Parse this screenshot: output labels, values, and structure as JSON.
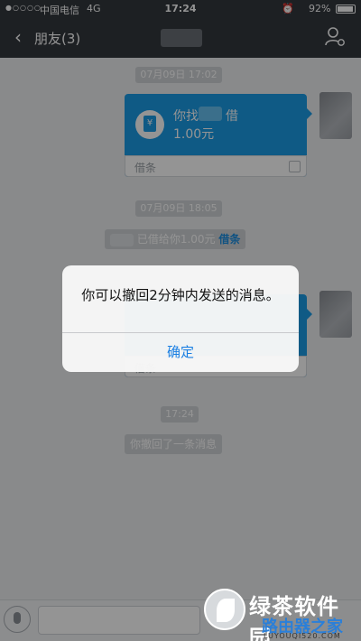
{
  "status_bar": {
    "signal": "●○○○○",
    "carrier": "中国电信",
    "network": "4G",
    "time": "17:24",
    "alarm_icon": "alarm-icon",
    "battery_text": "92%",
    "battery_level": 0.92
  },
  "nav": {
    "back_icon": "chevron-left-icon",
    "title": "朋友(3)",
    "profile_icon": "person-settings-icon"
  },
  "chat": {
    "timestamp1": "07月09日 17:02",
    "loan_bubble": {
      "line1_prefix": "你找",
      "line1_suffix": "借",
      "amount": "1.00元",
      "footer_label": "借条"
    },
    "timestamp2": "07月09日 18:05",
    "system_msg": {
      "text": "已借给你1.00元",
      "link": "借条"
    },
    "partial_footer": "借条",
    "timestamp3": "17:24",
    "recalled_msg": "你撤回了一条消息"
  },
  "alert": {
    "message": "你可以撤回2分钟内发送的消息。",
    "confirm": "确定"
  },
  "watermark": {
    "title": "绿茶软件园",
    "subtitle": "路由器之家",
    "url": "LUYOUQI520.COM"
  },
  "colors": {
    "accent": "#1a9be6",
    "navbar": "#33373d",
    "alert_button": "#1a7fe3"
  }
}
